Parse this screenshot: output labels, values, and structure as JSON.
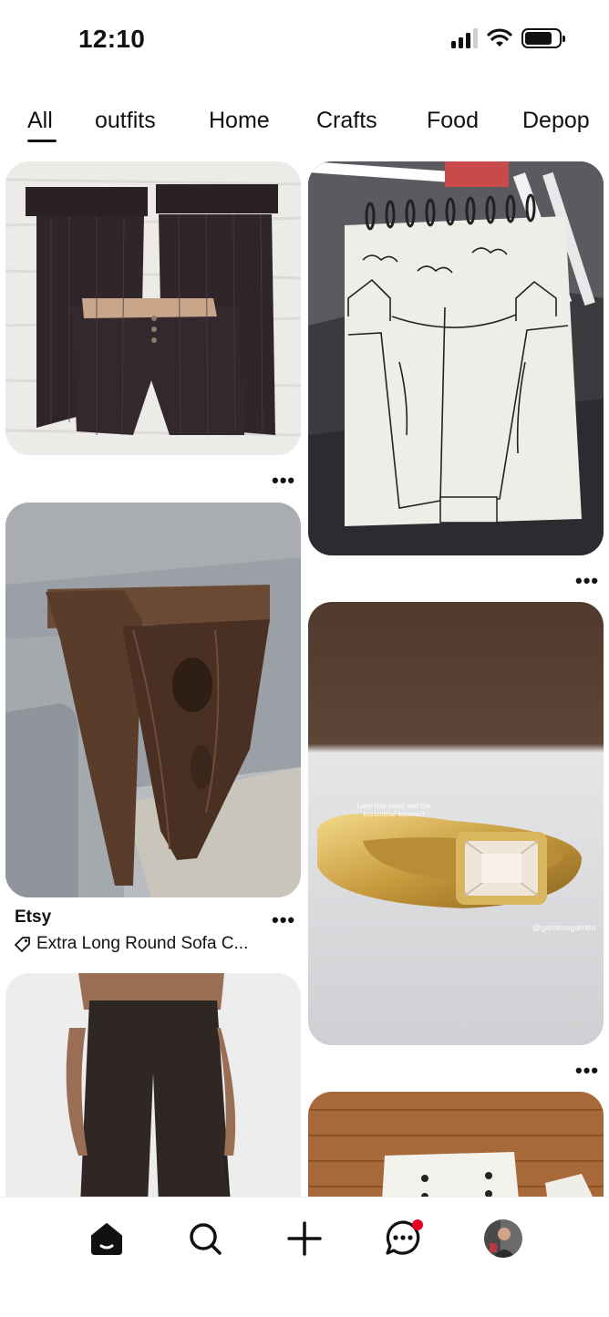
{
  "status_bar": {
    "time": "12:10"
  },
  "tabs": [
    "All",
    "outfits",
    "Home",
    "Crafts",
    "Food",
    "Depop"
  ],
  "feed": {
    "pins": [
      {
        "id": "pinstripe-trousers",
        "more": "•••"
      },
      {
        "id": "sketchbook-drawing",
        "more": "•••"
      },
      {
        "id": "walnut-sofa-table",
        "more": "•••",
        "source": "Etsy",
        "product": "Extra Long Round Sofa C..."
      },
      {
        "id": "gold-emerald-ring",
        "more": "•••",
        "overlay_text": "Love this band and the horizontal emerald",
        "watermark": "@gardensgarden"
      },
      {
        "id": "brown-flare-pants"
      },
      {
        "id": "white-sailor-shorts"
      }
    ]
  },
  "colors": {
    "text": "#111111",
    "notification_dot": "#e60023",
    "background": "#ffffff"
  },
  "bottom_nav": {
    "items": [
      "home-icon",
      "search-icon",
      "create-icon",
      "messages-icon",
      "profile-avatar"
    ]
  }
}
